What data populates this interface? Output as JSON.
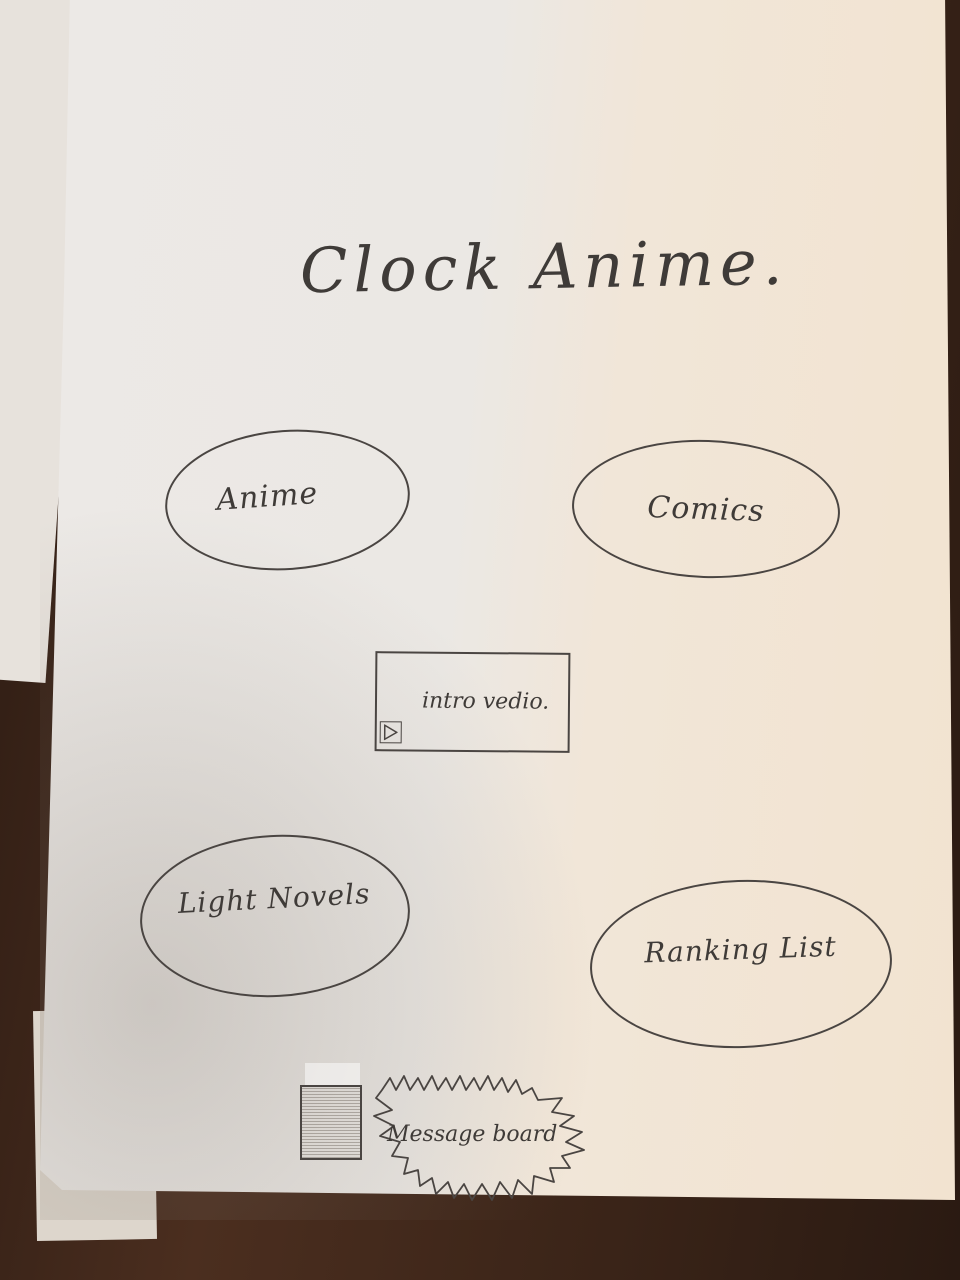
{
  "page": {
    "title": "Clock Anime."
  },
  "nav": {
    "anime": "Anime",
    "comics": "Comics",
    "light_novels": "Light Novels",
    "ranking_list": "Ranking List"
  },
  "video": {
    "label": "intro vedio."
  },
  "message_board": {
    "label": "Message board"
  },
  "colors": {
    "ink": "#3f3b38",
    "paper": "#ece9e6"
  }
}
